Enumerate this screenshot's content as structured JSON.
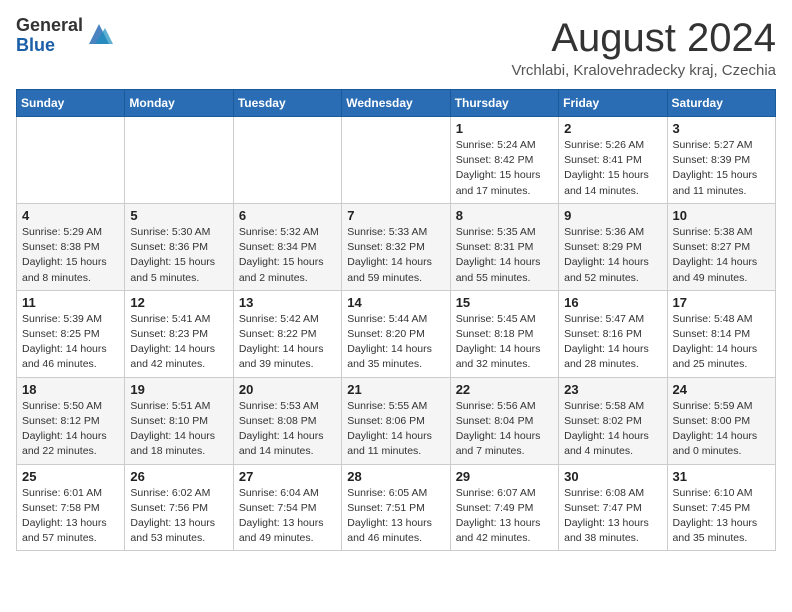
{
  "header": {
    "logo_general": "General",
    "logo_blue": "Blue",
    "month_title": "August 2024",
    "location": "Vrchlabi, Kralovehradecky kraj, Czechia"
  },
  "weekdays": [
    "Sunday",
    "Monday",
    "Tuesday",
    "Wednesday",
    "Thursday",
    "Friday",
    "Saturday"
  ],
  "weeks": [
    [
      {
        "day": "",
        "info": ""
      },
      {
        "day": "",
        "info": ""
      },
      {
        "day": "",
        "info": ""
      },
      {
        "day": "",
        "info": ""
      },
      {
        "day": "1",
        "info": "Sunrise: 5:24 AM\nSunset: 8:42 PM\nDaylight: 15 hours\nand 17 minutes."
      },
      {
        "day": "2",
        "info": "Sunrise: 5:26 AM\nSunset: 8:41 PM\nDaylight: 15 hours\nand 14 minutes."
      },
      {
        "day": "3",
        "info": "Sunrise: 5:27 AM\nSunset: 8:39 PM\nDaylight: 15 hours\nand 11 minutes."
      }
    ],
    [
      {
        "day": "4",
        "info": "Sunrise: 5:29 AM\nSunset: 8:38 PM\nDaylight: 15 hours\nand 8 minutes."
      },
      {
        "day": "5",
        "info": "Sunrise: 5:30 AM\nSunset: 8:36 PM\nDaylight: 15 hours\nand 5 minutes."
      },
      {
        "day": "6",
        "info": "Sunrise: 5:32 AM\nSunset: 8:34 PM\nDaylight: 15 hours\nand 2 minutes."
      },
      {
        "day": "7",
        "info": "Sunrise: 5:33 AM\nSunset: 8:32 PM\nDaylight: 14 hours\nand 59 minutes."
      },
      {
        "day": "8",
        "info": "Sunrise: 5:35 AM\nSunset: 8:31 PM\nDaylight: 14 hours\nand 55 minutes."
      },
      {
        "day": "9",
        "info": "Sunrise: 5:36 AM\nSunset: 8:29 PM\nDaylight: 14 hours\nand 52 minutes."
      },
      {
        "day": "10",
        "info": "Sunrise: 5:38 AM\nSunset: 8:27 PM\nDaylight: 14 hours\nand 49 minutes."
      }
    ],
    [
      {
        "day": "11",
        "info": "Sunrise: 5:39 AM\nSunset: 8:25 PM\nDaylight: 14 hours\nand 46 minutes."
      },
      {
        "day": "12",
        "info": "Sunrise: 5:41 AM\nSunset: 8:23 PM\nDaylight: 14 hours\nand 42 minutes."
      },
      {
        "day": "13",
        "info": "Sunrise: 5:42 AM\nSunset: 8:22 PM\nDaylight: 14 hours\nand 39 minutes."
      },
      {
        "day": "14",
        "info": "Sunrise: 5:44 AM\nSunset: 8:20 PM\nDaylight: 14 hours\nand 35 minutes."
      },
      {
        "day": "15",
        "info": "Sunrise: 5:45 AM\nSunset: 8:18 PM\nDaylight: 14 hours\nand 32 minutes."
      },
      {
        "day": "16",
        "info": "Sunrise: 5:47 AM\nSunset: 8:16 PM\nDaylight: 14 hours\nand 28 minutes."
      },
      {
        "day": "17",
        "info": "Sunrise: 5:48 AM\nSunset: 8:14 PM\nDaylight: 14 hours\nand 25 minutes."
      }
    ],
    [
      {
        "day": "18",
        "info": "Sunrise: 5:50 AM\nSunset: 8:12 PM\nDaylight: 14 hours\nand 22 minutes."
      },
      {
        "day": "19",
        "info": "Sunrise: 5:51 AM\nSunset: 8:10 PM\nDaylight: 14 hours\nand 18 minutes."
      },
      {
        "day": "20",
        "info": "Sunrise: 5:53 AM\nSunset: 8:08 PM\nDaylight: 14 hours\nand 14 minutes."
      },
      {
        "day": "21",
        "info": "Sunrise: 5:55 AM\nSunset: 8:06 PM\nDaylight: 14 hours\nand 11 minutes."
      },
      {
        "day": "22",
        "info": "Sunrise: 5:56 AM\nSunset: 8:04 PM\nDaylight: 14 hours\nand 7 minutes."
      },
      {
        "day": "23",
        "info": "Sunrise: 5:58 AM\nSunset: 8:02 PM\nDaylight: 14 hours\nand 4 minutes."
      },
      {
        "day": "24",
        "info": "Sunrise: 5:59 AM\nSunset: 8:00 PM\nDaylight: 14 hours\nand 0 minutes."
      }
    ],
    [
      {
        "day": "25",
        "info": "Sunrise: 6:01 AM\nSunset: 7:58 PM\nDaylight: 13 hours\nand 57 minutes."
      },
      {
        "day": "26",
        "info": "Sunrise: 6:02 AM\nSunset: 7:56 PM\nDaylight: 13 hours\nand 53 minutes."
      },
      {
        "day": "27",
        "info": "Sunrise: 6:04 AM\nSunset: 7:54 PM\nDaylight: 13 hours\nand 49 minutes."
      },
      {
        "day": "28",
        "info": "Sunrise: 6:05 AM\nSunset: 7:51 PM\nDaylight: 13 hours\nand 46 minutes."
      },
      {
        "day": "29",
        "info": "Sunrise: 6:07 AM\nSunset: 7:49 PM\nDaylight: 13 hours\nand 42 minutes."
      },
      {
        "day": "30",
        "info": "Sunrise: 6:08 AM\nSunset: 7:47 PM\nDaylight: 13 hours\nand 38 minutes."
      },
      {
        "day": "31",
        "info": "Sunrise: 6:10 AM\nSunset: 7:45 PM\nDaylight: 13 hours\nand 35 minutes."
      }
    ]
  ]
}
